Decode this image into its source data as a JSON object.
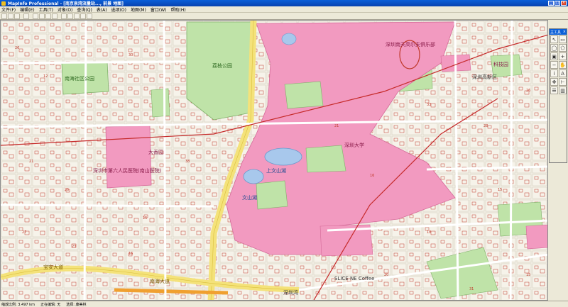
{
  "window": {
    "title": "MapInfo Professional - [南京泉湾流量站..., 前景 地图]"
  },
  "menu": {
    "items": [
      "文件(F)",
      "编辑(E)",
      "工具(T)",
      "对象(O)",
      "查询(Q)",
      "表(A)",
      "选项(O)",
      "地图(M)",
      "窗口(W)",
      "帮助(H)"
    ]
  },
  "palette": {
    "title": "主工具",
    "tools": [
      "select-icon",
      "marquee-icon",
      "radius-icon",
      "polygon-select-icon",
      "boundary-icon",
      "zoom-in-icon",
      "zoom-out-icon",
      "hand-icon",
      "info-icon",
      "label-icon",
      "drag-icon",
      "ruler-icon",
      "legend-icon",
      "graph-icon"
    ]
  },
  "map": {
    "labels": {
      "park_main": "荔枝公园",
      "park_nanshan": "南海社区公园",
      "club": "深圳南天高尔夫俱乐部",
      "university": "深圳大学",
      "lake_upper": "上文山湖",
      "lake_lower": "文山湖",
      "hospital": "深圳市第六人民医院(南山医院)",
      "xiangting": "大香园",
      "hightech": "深圳高新区",
      "kejiyuan": "科技园",
      "yilong": "南海大道",
      "coffee": "SLICE NE Coffee",
      "shenzhen_wan": "深圳湾",
      "baoan": "宝安大道"
    }
  },
  "status": {
    "zoom": "缩放比例: 3.497 km",
    "mode": "正在编辑: 无",
    "select": "选择: 康美林"
  },
  "colors": {
    "title_blue": "#0a5fd8",
    "campus_pink": "#f29ac0",
    "park_green": "#bfe3a8",
    "water_blue": "#a8c8ec",
    "road_yellow": "#f4e27a",
    "rail_red": "#c62a2a",
    "bg": "#f2efe6"
  }
}
